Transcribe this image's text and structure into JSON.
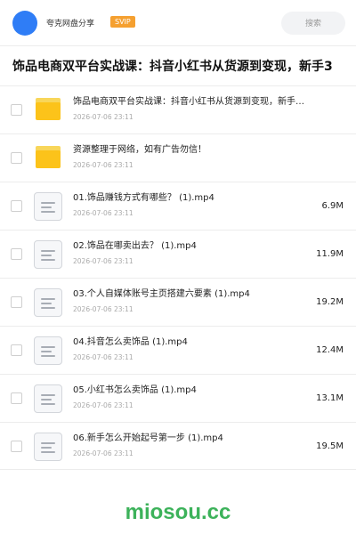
{
  "header": {
    "brand": "夸克网盘分享",
    "badge": "SVIP",
    "search_placeholder": "搜索"
  },
  "page_title": "饰品电商双平台实战课：抖音小红书从货源到变现，新手3",
  "items": [
    {
      "type": "folder",
      "name": "饰品电商双平台实战课：抖音小红书从货源到变现，新手…",
      "date": "2026-07-06 23:11",
      "size": ""
    },
    {
      "type": "folder",
      "name": "资源整理于网络，如有广告勿信！",
      "date": "2026-07-06 23:11",
      "size": ""
    },
    {
      "type": "file",
      "name": "01.饰品赚钱方式有哪些？ (1).mp4",
      "date": "2026-07-06 23:11",
      "size": "6.9M"
    },
    {
      "type": "file",
      "name": "02.饰品在哪卖出去？ (1).mp4",
      "date": "2026-07-06 23:11",
      "size": "11.9M"
    },
    {
      "type": "file",
      "name": "03.个人自媒体账号主页搭建六要素 (1).mp4",
      "date": "2026-07-06 23:11",
      "size": "19.2M"
    },
    {
      "type": "file",
      "name": "04.抖音怎么卖饰品 (1).mp4",
      "date": "2026-07-06 23:11",
      "size": "12.4M"
    },
    {
      "type": "file",
      "name": "05.小红书怎么卖饰品 (1).mp4",
      "date": "2026-07-06 23:11",
      "size": "13.1M"
    },
    {
      "type": "file",
      "name": "06.新手怎么开始起号第一步 (1).mp4",
      "date": "2026-07-06 23:11",
      "size": "19.5M"
    }
  ],
  "watermark": "miosou.cc",
  "colors": {
    "avatar": "#2f7df6",
    "badge": "#f5a030",
    "folder": "#fcc31a",
    "watermark": "#3cb25a"
  }
}
